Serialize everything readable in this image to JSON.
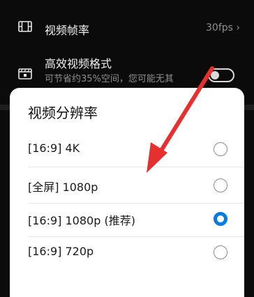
{
  "settings": {
    "frame_rate": {
      "label": "视频帧率",
      "value": "30fps ›"
    },
    "efficient_format": {
      "label": "高效视频格式",
      "subtitle": "可节省约35%空间，您可能无其"
    }
  },
  "dialog": {
    "title": "视频分辨率",
    "options": [
      {
        "label": "[16:9] 4K",
        "selected": false
      },
      {
        "label": "[全屏] 1080p",
        "selected": false
      },
      {
        "label": "[16:9] 1080p (推荐)",
        "selected": true
      },
      {
        "label": "[16:9] 720p",
        "selected": false
      }
    ]
  },
  "colors": {
    "accent": "#0a7bd9",
    "arrow": "#e53030"
  }
}
